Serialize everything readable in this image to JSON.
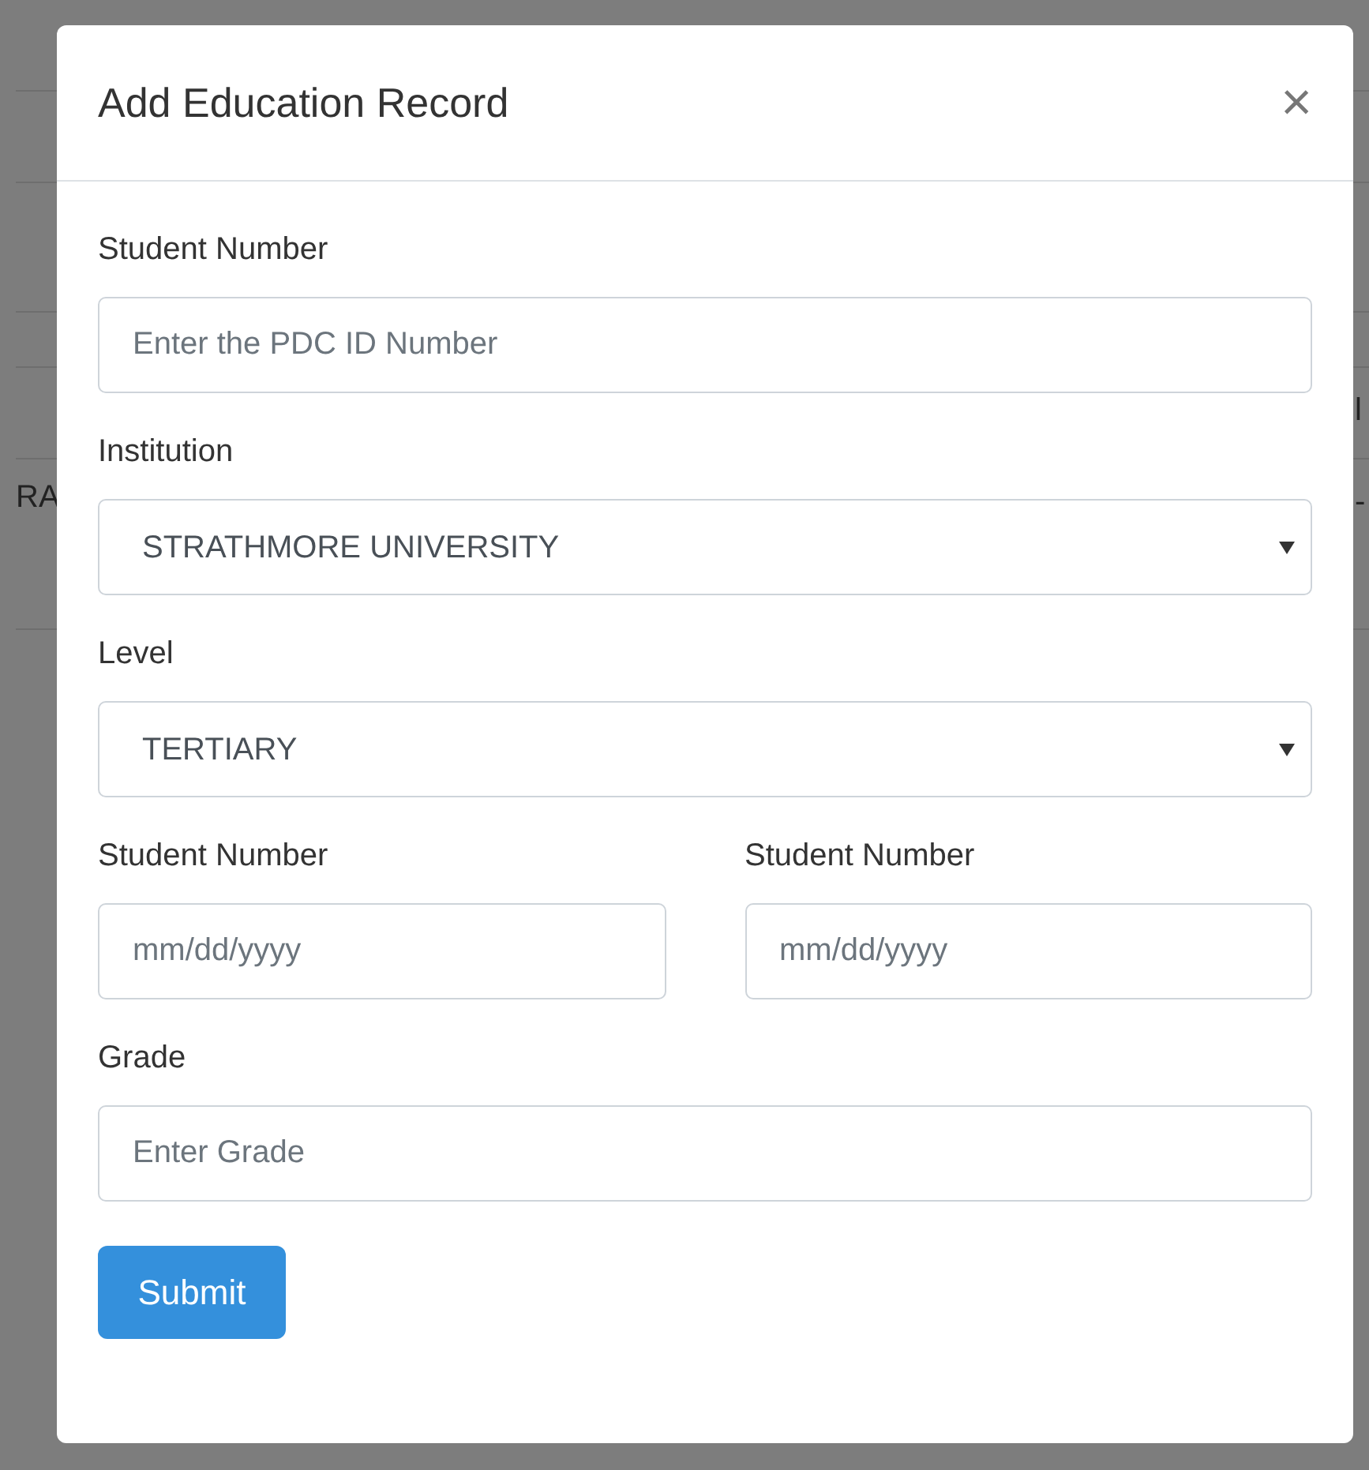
{
  "background": {
    "left_texts": [
      "RA"
    ],
    "right_texts": [
      "l",
      "-"
    ]
  },
  "modal": {
    "title": "Add Education Record",
    "close": "×",
    "fields": [
      {
        "kind": "text",
        "label": "Student Number",
        "placeholder": "Enter the PDC ID Number"
      },
      {
        "kind": "select",
        "label": "Institution",
        "value": "STRATHMORE UNIVERSITY"
      },
      {
        "kind": "select",
        "label": "Level",
        "value": "TERTIARY"
      },
      {
        "kind": "dates",
        "items": [
          {
            "label": "Student Number",
            "placeholder": "mm/dd/yyyy"
          },
          {
            "label": "Student Number",
            "placeholder": "mm/dd/yyyy"
          }
        ]
      },
      {
        "kind": "text",
        "label": "Grade",
        "placeholder": "Enter Grade"
      }
    ],
    "submit": "Submit"
  }
}
